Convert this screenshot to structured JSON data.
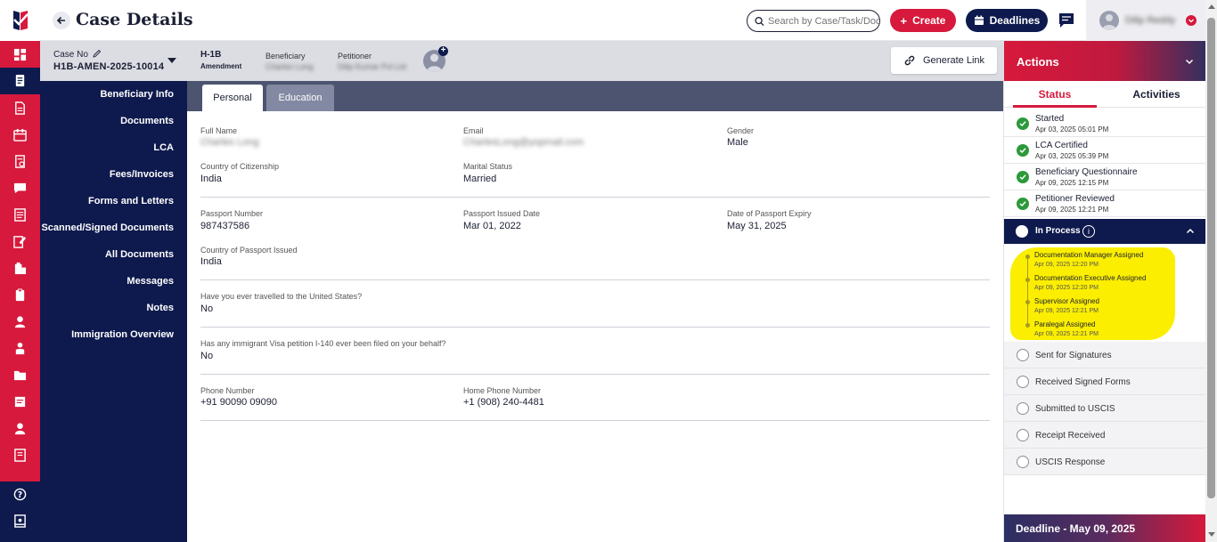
{
  "header": {
    "title": "Case Details",
    "search_placeholder": "Search by Case/Task/Document",
    "create_label": "Create",
    "deadlines_label": "Deadlines",
    "user_name": "Dilip Reddy"
  },
  "case": {
    "case_no_label": "Case No",
    "case_no_value": "H1B-AMEN-2025-10014",
    "visa_type": "H-1B",
    "visa_subtype": "Amendment",
    "beneficiary_label": "Beneficiary",
    "beneficiary_value": "Charles Long",
    "petitioner_label": "Petitioner",
    "petitioner_value": "Dilip Kumar Pvt Ltd",
    "generate_link_label": "Generate Link"
  },
  "leftnav": {
    "items": [
      "Beneficiary Info",
      "Documents",
      "LCA",
      "Fees/Invoices",
      "Forms and Letters",
      "Scanned/Signed Documents",
      "All Documents",
      "Messages",
      "Notes",
      "Immigration Overview"
    ]
  },
  "tabs": {
    "personal": "Personal",
    "education": "Education"
  },
  "fields": {
    "full_name_label": "Full Name",
    "full_name_value": "Charles Long",
    "email_label": "Email",
    "email_value": "CharlesLong@yopmail.com",
    "gender_label": "Gender",
    "gender_value": "Male",
    "citizenship_label": "Country of Citizenship",
    "citizenship_value": "India",
    "marital_label": "Marital Status",
    "marital_value": "Married",
    "passport_no_label": "Passport Number",
    "passport_no_value": "987437586",
    "passport_issued_label": "Passport Issued Date",
    "passport_issued_value": "Mar 01, 2022",
    "passport_expiry_label": "Date of Passport Expiry",
    "passport_expiry_value": "May 31, 2025",
    "passport_country_label": "Country of Passport Issued",
    "passport_country_value": "India",
    "travelled_label": "Have you ever travelled to the United States?",
    "travelled_value": "No",
    "i140_label": "Has any immigrant Visa petition I-140 ever been filed on your behalf?",
    "i140_value": "No",
    "phone_label": "Phone Number",
    "phone_value": "+91  90090 09090",
    "home_phone_label": "Home Phone Number",
    "home_phone_value": "+1  (908) 240-4481"
  },
  "actions": {
    "title": "Actions",
    "tab_status": "Status",
    "tab_activities": "Activities",
    "completed": [
      {
        "title": "Started",
        "date": "Apr 03, 2025 05:01 PM"
      },
      {
        "title": "LCA Certified",
        "date": "Apr 03, 2025 05:39 PM"
      },
      {
        "title": "Beneficiary Questionnaire",
        "date": "Apr 09, 2025 12:15 PM"
      },
      {
        "title": "Petitioner Reviewed",
        "date": "Apr 09, 2025 12:21 PM"
      }
    ],
    "in_process": {
      "title": "In Process",
      "info": "i",
      "substeps": [
        {
          "title": "Documentation Manager Assigned",
          "date": "Apr 09, 2025 12:20 PM"
        },
        {
          "title": "Documentation Executive Assigned",
          "date": "Apr 09, 2025 12:20 PM"
        },
        {
          "title": "Supervisor Assigned",
          "date": "Apr 09, 2025 12:21 PM"
        },
        {
          "title": "Paralegal Assigned",
          "date": "Apr 09, 2025 12:21 PM"
        }
      ]
    },
    "pending": [
      "Sent for Signatures",
      "Received Signed Forms",
      "Submitted to USCIS",
      "Receipt Received",
      "USCIS Response"
    ],
    "deadline": "Deadline - May 09, 2025"
  },
  "colors": {
    "brand_red": "#d6193c",
    "navy": "#0e1a4d",
    "success": "#2c9a3a",
    "highlight": "#fbee00"
  },
  "icons": {
    "rail": [
      "dashboard-icon",
      "case-icon",
      "document-icon",
      "calendar-icon",
      "report-icon",
      "chat-icon",
      "form-icon",
      "edit-icon",
      "building-icon",
      "clipboard-icon",
      "user-icon",
      "team-icon",
      "folder-icon",
      "note-icon",
      "profile-icon",
      "book-icon",
      "help-icon",
      "guide-icon"
    ]
  }
}
